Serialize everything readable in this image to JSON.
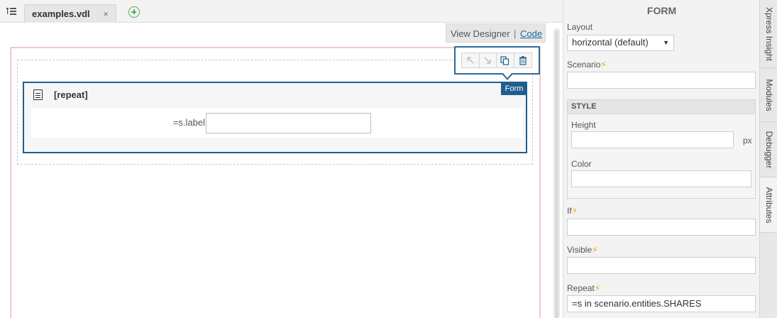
{
  "tabs": [
    {
      "label": "examples.vdl",
      "close": "×"
    }
  ],
  "view_switch": {
    "designer": "View Designer",
    "separator": "|",
    "code": "Code"
  },
  "form_block": {
    "badge": "Form",
    "title": "[repeat]",
    "row_label": "=s.label",
    "row_value": ""
  },
  "toolbar_icons": [
    "move-up-icon",
    "move-down-icon",
    "duplicate-icon",
    "delete-icon"
  ],
  "panel": {
    "title": "FORM",
    "layout_label": "Layout",
    "layout_value": "horizontal (default)",
    "scenario_label": "Scenario",
    "scenario_value": "",
    "style_heading": "STYLE",
    "height_label": "Height",
    "height_value": "",
    "height_unit": "px",
    "color_label": "Color",
    "color_value": "",
    "if_label": "If",
    "if_value": "",
    "visible_label": "Visible",
    "visible_value": "",
    "repeat_label": "Repeat",
    "repeat_value": "=s in scenario.entities.SHARES"
  },
  "side_tabs": [
    "Xpress Insight",
    "Modules",
    "Debugger",
    "Attributes"
  ],
  "colors": {
    "accent": "#1f5f8d",
    "link": "#1565a0",
    "bolt": "#f0a800",
    "add": "#4caf50",
    "canvas_border": "#f5c9c9"
  }
}
